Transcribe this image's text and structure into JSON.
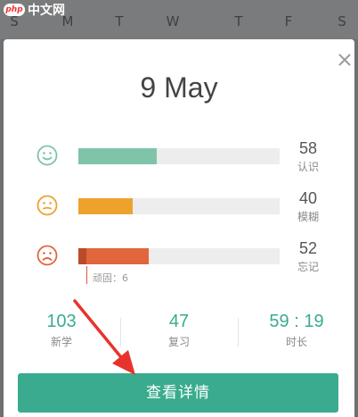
{
  "watermark": {
    "logo_text": "php",
    "site_text": "中文网"
  },
  "background": {
    "weekdays": [
      "S",
      "M",
      "T",
      "W",
      "T",
      "F",
      "S"
    ]
  },
  "dialog": {
    "date_title": "9 May",
    "stats": [
      {
        "label": "认识",
        "count": "58",
        "fill_fraction": 0.39,
        "color": "#7fc4a9",
        "face": "happy-face-icon"
      },
      {
        "label": "模糊",
        "count": "40",
        "fill_fraction": 0.27,
        "color": "#eda22d",
        "face": "neutral-face-icon"
      },
      {
        "label": "忘记",
        "count": "52",
        "fill_fraction": 0.35,
        "color": "#e0663c",
        "stubborn_fraction": 0.04,
        "face": "sad-face-icon"
      }
    ],
    "stubborn_label": "顽固：6",
    "summary": [
      {
        "value": "103",
        "label": "新学"
      },
      {
        "value": "47",
        "label": "复习"
      },
      {
        "value": "59 : 19",
        "label": "时长"
      }
    ],
    "details_button": "查看详情"
  },
  "colors": {
    "accent": "#3aab8f",
    "arrow": "#e8332d"
  }
}
